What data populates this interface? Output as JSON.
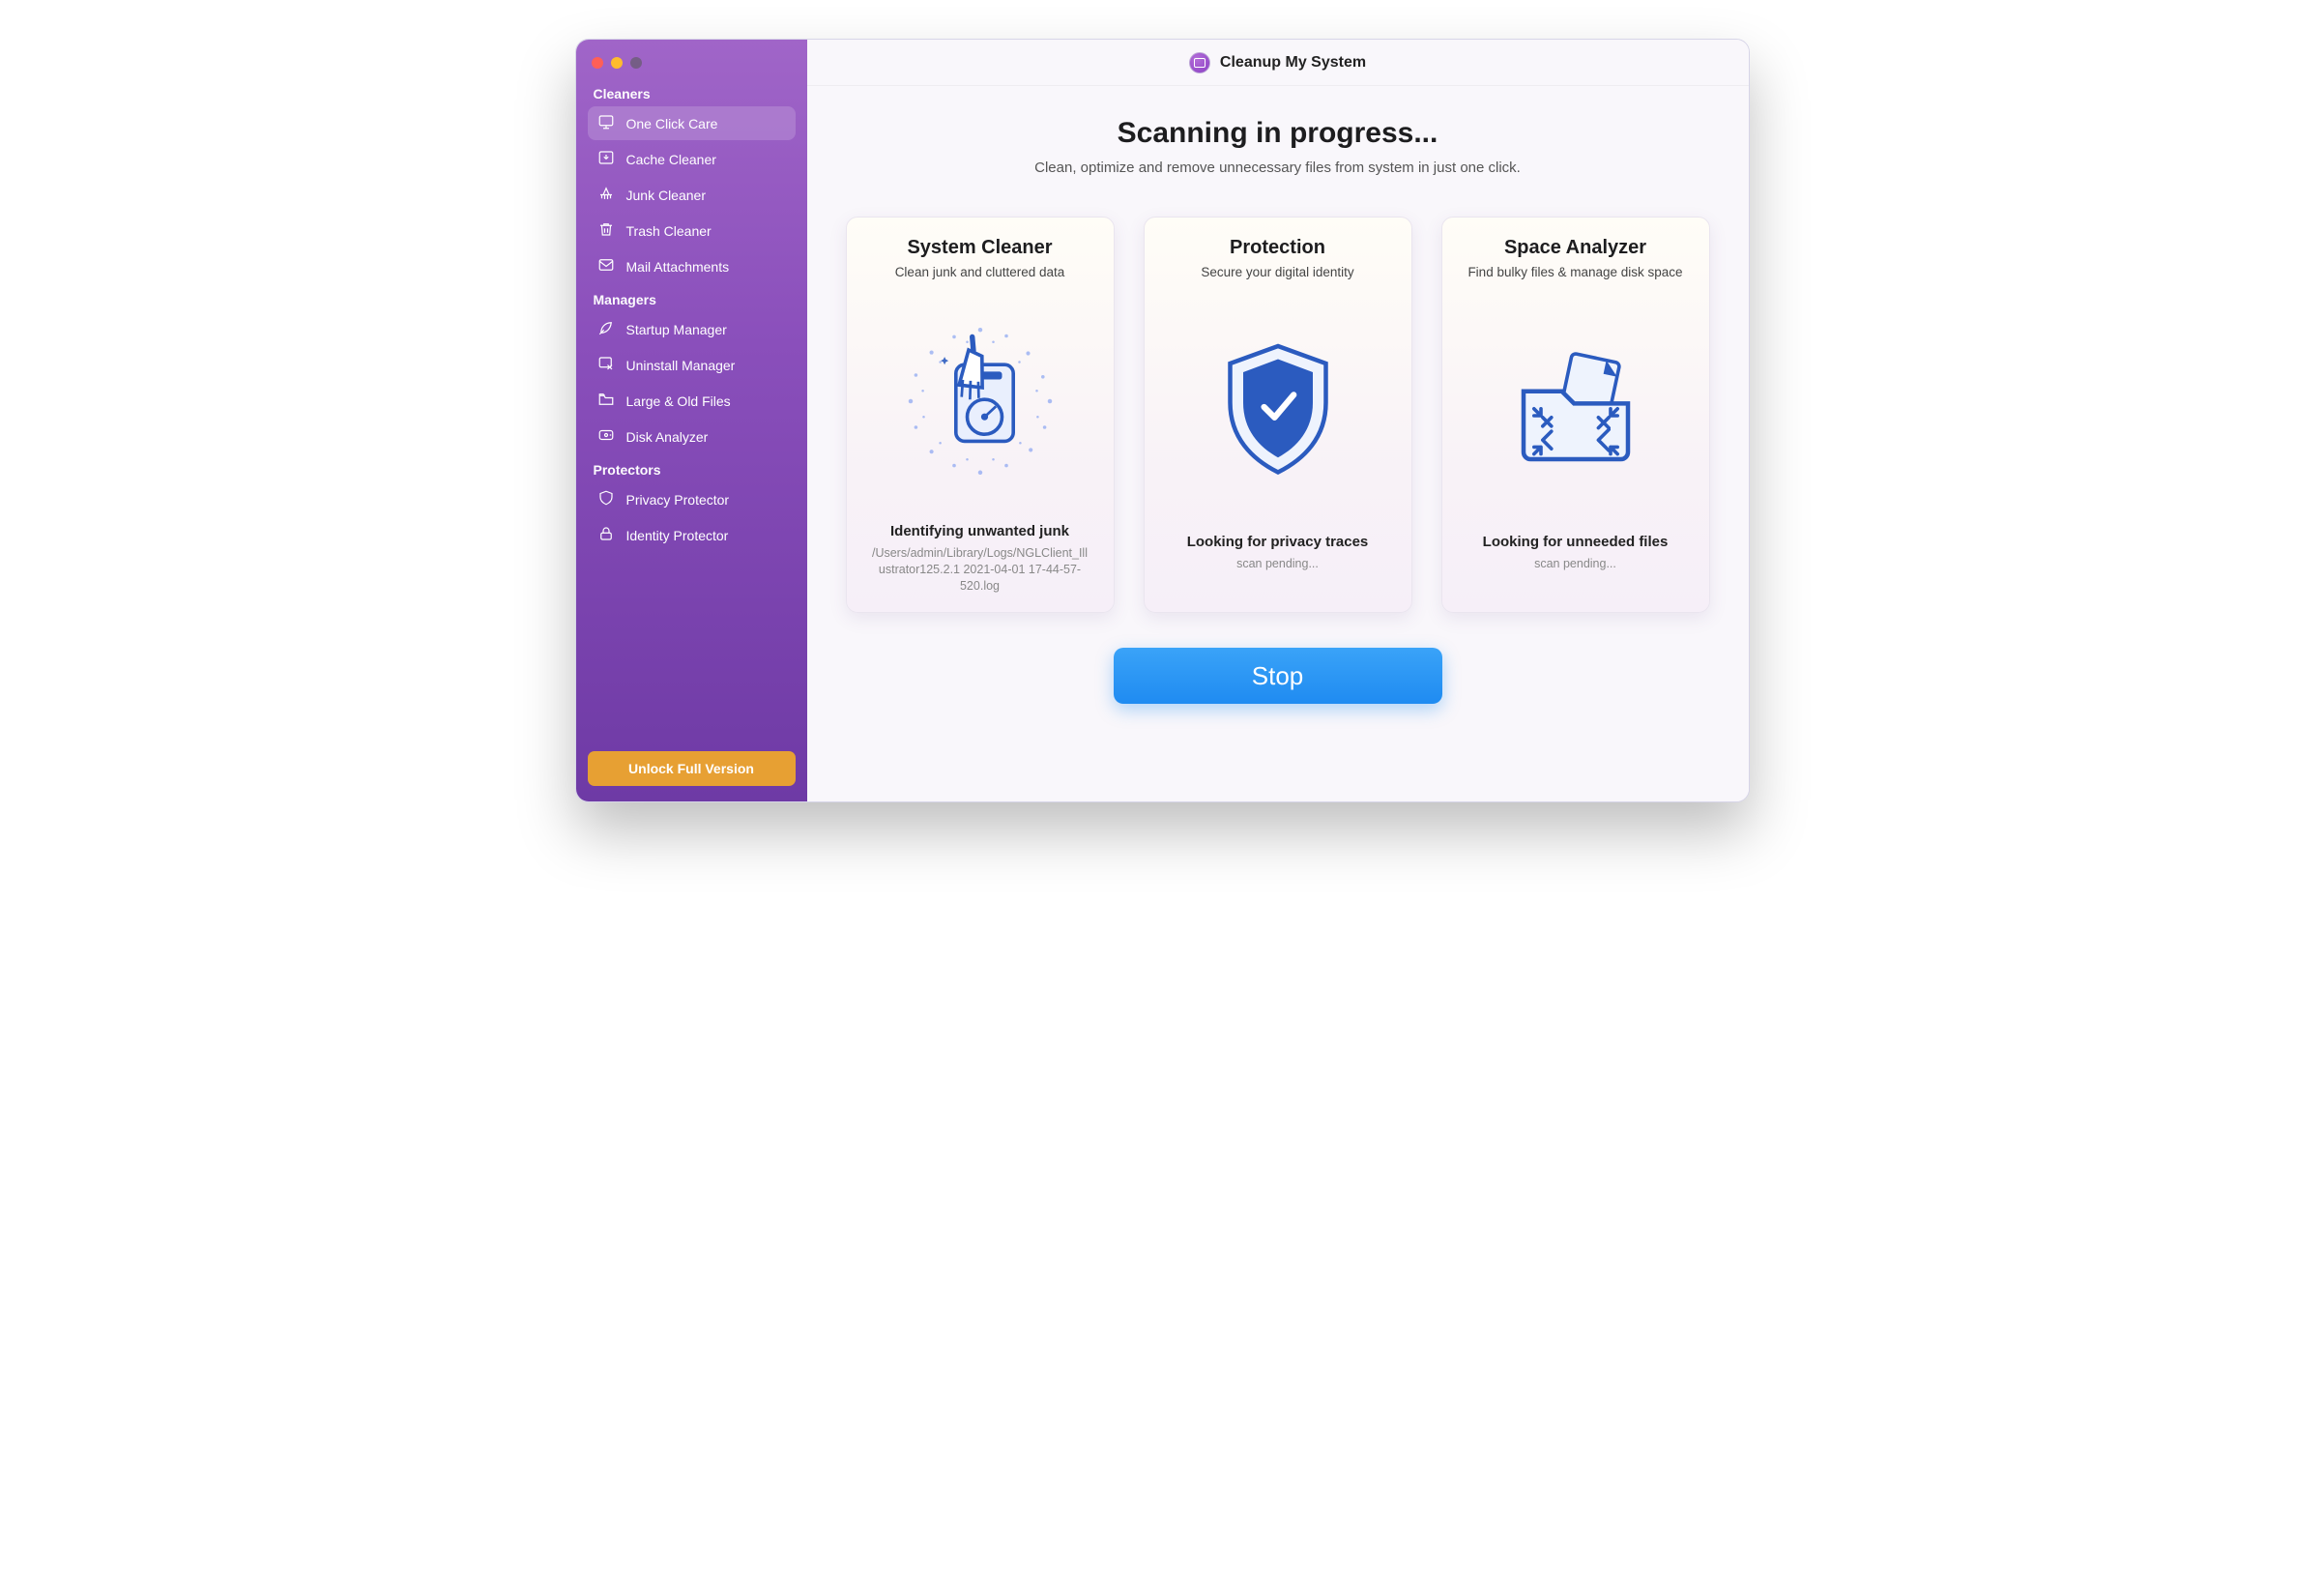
{
  "app": {
    "title": "Cleanup My System"
  },
  "sidebar": {
    "sections": [
      {
        "label": "Cleaners",
        "items": [
          {
            "label": "One Click Care",
            "icon": "monitor-icon",
            "active": true
          },
          {
            "label": "Cache Cleaner",
            "icon": "download-box-icon"
          },
          {
            "label": "Junk Cleaner",
            "icon": "broom-icon"
          },
          {
            "label": "Trash Cleaner",
            "icon": "trash-icon"
          },
          {
            "label": "Mail Attachments",
            "icon": "mail-icon"
          }
        ]
      },
      {
        "label": "Managers",
        "items": [
          {
            "label": "Startup Manager",
            "icon": "rocket-icon"
          },
          {
            "label": "Uninstall Manager",
            "icon": "uninstall-icon"
          },
          {
            "label": "Large & Old Files",
            "icon": "folder-icon"
          },
          {
            "label": "Disk Analyzer",
            "icon": "disk-icon"
          }
        ]
      },
      {
        "label": "Protectors",
        "items": [
          {
            "label": "Privacy Protector",
            "icon": "shield-icon"
          },
          {
            "label": "Identity Protector",
            "icon": "lock-icon"
          }
        ]
      }
    ],
    "unlock_label": "Unlock Full Version"
  },
  "main": {
    "heading": "Scanning in progress...",
    "subheading": "Clean, optimize and remove unnecessary files from system in just one click.",
    "cards": [
      {
        "title": "System Cleaner",
        "subtitle": "Clean junk and cluttered data",
        "status": "Identifying unwanted junk",
        "status_sub": "/Users/admin/Library/Logs/NGLClient_Illustrator125.2.1 2021-04-01 17-44-57-520.log"
      },
      {
        "title": "Protection",
        "subtitle": "Secure your digital identity",
        "status": "Looking for privacy traces",
        "status_sub": "scan pending..."
      },
      {
        "title": "Space Analyzer",
        "subtitle": "Find bulky files & manage disk space",
        "status": "Looking for unneeded files",
        "status_sub": "scan pending..."
      }
    ],
    "stop_label": "Stop"
  }
}
